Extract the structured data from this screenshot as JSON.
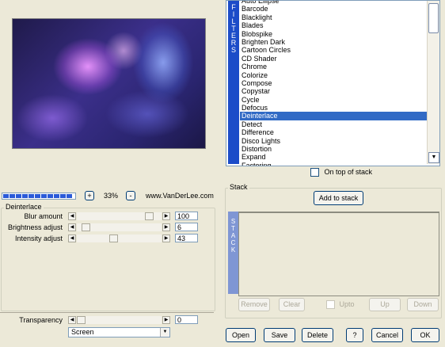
{
  "filters": {
    "band_label": "FILTERS",
    "items": [
      "Auto Ellipse",
      "Barcode",
      "Blacklight",
      "Blades",
      "Blobspike",
      "Brighten Dark",
      "Cartoon Circles",
      "CD Shader",
      "Chrome",
      "Colorize",
      "Compose",
      "Copystar",
      "Cycle",
      "Defocus",
      "Deinterlace",
      "Detect",
      "Difference",
      "Disco Lights",
      "Distortion",
      "Expand",
      "Factoring"
    ],
    "selected": "Deinterlace",
    "on_top_label": "On top of stack"
  },
  "zoom": {
    "value": "33%",
    "plus": "+",
    "minus": "-",
    "progress_fraction": 1.0
  },
  "credit": "www.VanDerLee.com",
  "params": {
    "title": "Deinterlace",
    "rows": [
      {
        "label": "Blur amount",
        "value": "100",
        "level": 0.9
      },
      {
        "label": "Brightness adjust",
        "value": "6",
        "level": 0.06
      },
      {
        "label": "Intensity adjust",
        "value": "43",
        "level": 0.43
      }
    ]
  },
  "stack": {
    "title": "Stack",
    "add_label": "Add to stack",
    "band_label": "STACK",
    "remove": "Remove",
    "clear": "Clear",
    "upto": "Upto",
    "up": "Up",
    "down": "Down"
  },
  "transparency": {
    "label": "Transparency",
    "value": "0",
    "level": 0.0
  },
  "blend_mode": "Screen",
  "buttons": {
    "open": "Open",
    "save": "Save",
    "delete": "Delete",
    "help": "?",
    "cancel": "Cancel",
    "ok": "OK"
  }
}
